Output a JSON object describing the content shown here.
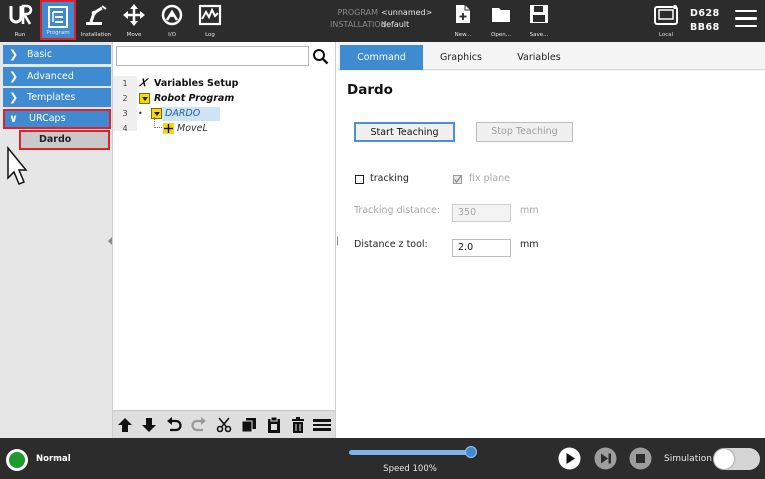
{
  "topbar": {
    "nav": [
      {
        "id": "run",
        "label": "Run",
        "icon": "ur-logo-icon"
      },
      {
        "id": "program",
        "label": "Program",
        "icon": "program-icon"
      },
      {
        "id": "installation",
        "label": "Installation",
        "icon": "installation-icon"
      },
      {
        "id": "move",
        "label": "Move",
        "icon": "move-icon"
      },
      {
        "id": "io",
        "label": "I/O",
        "icon": "io-icon"
      },
      {
        "id": "log",
        "label": "Log",
        "icon": "log-icon"
      }
    ],
    "program_key": "PROGRAM",
    "program_value": "<unnamed>",
    "installation_key": "INSTALLATION",
    "installation_value": "default",
    "file_actions": [
      {
        "id": "new",
        "label": "New...",
        "icon": "new-file-icon"
      },
      {
        "id": "open",
        "label": "Open...",
        "icon": "folder-open-icon"
      },
      {
        "id": "save",
        "label": "Save...",
        "icon": "save-icon"
      }
    ],
    "local_label": "Local",
    "serial_1": "D628",
    "serial_2": "BB68"
  },
  "left_panel": {
    "categories": [
      {
        "label": "Basic",
        "expanded": false
      },
      {
        "label": "Advanced",
        "expanded": false
      },
      {
        "label": "Templates",
        "expanded": false
      },
      {
        "label": "URCaps",
        "expanded": true
      }
    ],
    "urcap_items": [
      "Dardo"
    ]
  },
  "tree": {
    "search_value": "",
    "rows": [
      {
        "num": "1",
        "label": "Variables Setup",
        "icon": "variables-icon"
      },
      {
        "num": "2",
        "label": "Robot Program",
        "icon": "program-node-icon"
      },
      {
        "num": "3",
        "label": "DARDO",
        "icon": "urcap-node-icon"
      },
      {
        "num": "4",
        "label": "MoveL",
        "icon": "move-node-icon"
      }
    ]
  },
  "right_panel": {
    "tabs": [
      "Command",
      "Graphics",
      "Variables"
    ],
    "active_tab": "Command",
    "title": "Dardo",
    "start_teaching": "Start Teaching",
    "stop_teaching": "Stop Teaching",
    "tracking_label": "tracking",
    "tracking_checked": false,
    "fix_plane_label": "fix plane",
    "fix_plane_checked": true,
    "tracking_distance_label": "Tracking distance:",
    "tracking_distance_value": "350",
    "tracking_distance_unit": "mm",
    "distance_z_label": "Distance z tool:",
    "distance_z_value": "2.0",
    "distance_z_unit": "mm"
  },
  "bottombar": {
    "status": "Normal",
    "speed_fraction": 1.0,
    "speed_label": "Speed 100%",
    "simulation_label": "Simulation",
    "simulation_on": false
  },
  "colors": {
    "accent": "#3f8bd2",
    "highlight_border": "#e0202a",
    "bar_bg": "#2c2c2c",
    "status_ok": "#1c9a2d"
  }
}
